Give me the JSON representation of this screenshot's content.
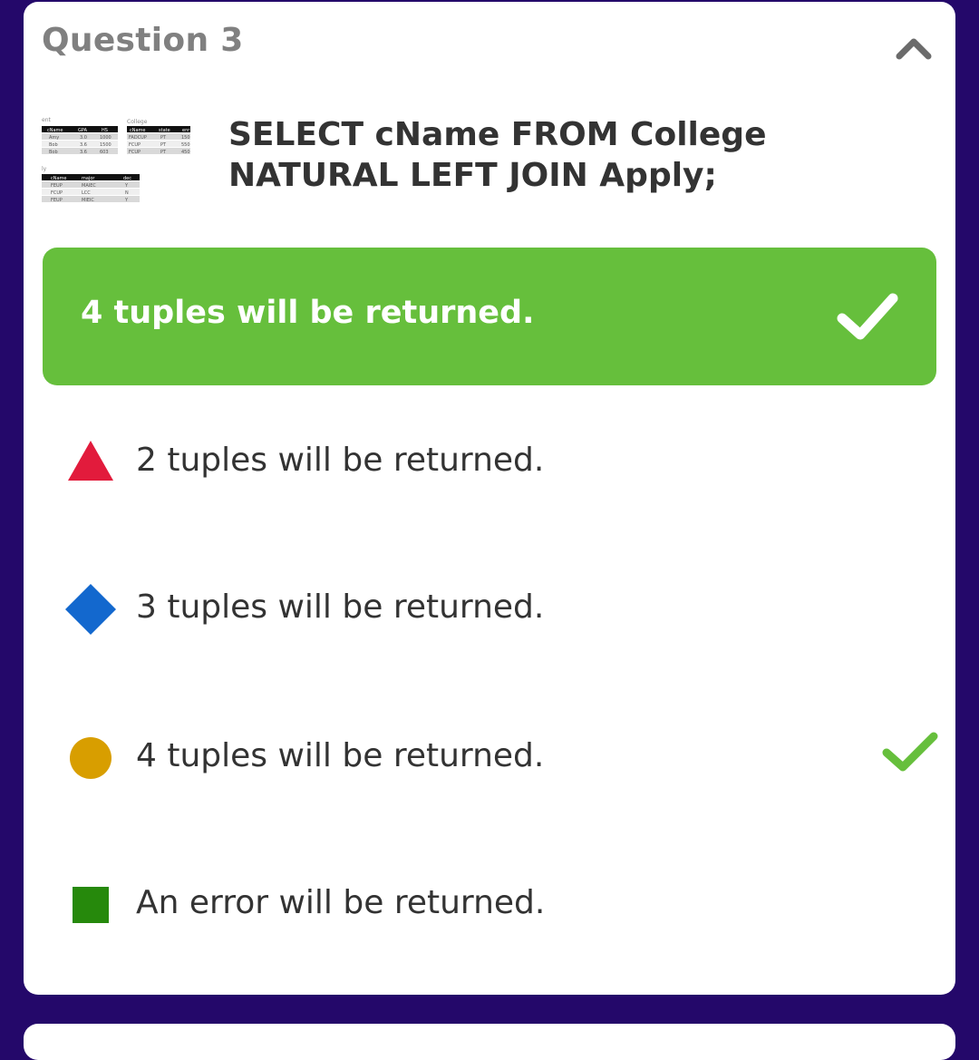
{
  "question": {
    "title": "Question 3",
    "text": "SELECT cName FROM College NATURAL LEFT JOIN Apply;"
  },
  "thumbnail": {
    "labels": [
      "ent",
      "College",
      "ly"
    ],
    "student_headers": [
      "cName",
      "GPA",
      "HS"
    ],
    "student_rows": [
      [
        "Amy",
        "3.0",
        "1000"
      ],
      [
        "Bob",
        "3.6",
        "1500"
      ],
      [
        "Bob",
        "3.6",
        "603"
      ]
    ],
    "college_headers": [
      "cName",
      "state",
      "enr"
    ],
    "college_rows": [
      [
        "FADCUP",
        "PT",
        "150"
      ],
      [
        "FCUP",
        "PT",
        "550"
      ],
      [
        "FCUP",
        "PT",
        "450"
      ]
    ],
    "apply_headers": [
      "cName",
      "major",
      "dec"
    ],
    "apply_rows": [
      [
        "FEUP",
        "MAIEC",
        "Y"
      ],
      [
        "FCUP",
        "LCC",
        "N"
      ],
      [
        "FEUP",
        "MIEIC",
        "Y"
      ]
    ]
  },
  "correct_answer": {
    "text": "4 tuples will be returned.",
    "icon": "checkmark-icon",
    "color": "#66bf3c"
  },
  "options": [
    {
      "text": "2 tuples will be returned.",
      "shape": "triangle-icon",
      "color": "#e21b3c",
      "correct": false
    },
    {
      "text": "3 tuples will be returned.",
      "shape": "diamond-icon",
      "color": "#1368ce",
      "correct": false
    },
    {
      "text": "4 tuples will be returned.",
      "shape": "circle-icon",
      "color": "#d89e00",
      "correct": true
    },
    {
      "text": "An error will be returned.",
      "shape": "square-icon",
      "color": "#26890c",
      "correct": false
    }
  ],
  "colors": {
    "background": "#24086a",
    "card": "#ffffff",
    "correct": "#66bf3c",
    "check_mark": "#66bf3c"
  }
}
